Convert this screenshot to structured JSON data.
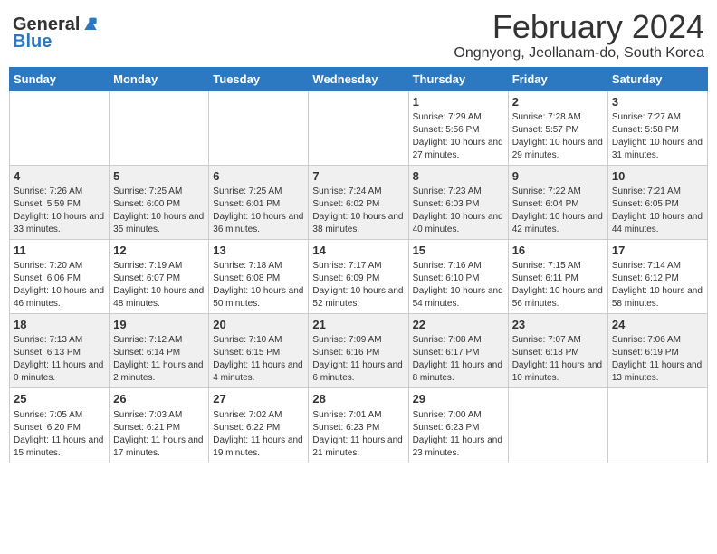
{
  "header": {
    "logo_general": "General",
    "logo_blue": "Blue",
    "title": "February 2024",
    "subtitle": "Ongnyong, Jeollanam-do, South Korea"
  },
  "days_of_week": [
    "Sunday",
    "Monday",
    "Tuesday",
    "Wednesday",
    "Thursday",
    "Friday",
    "Saturday"
  ],
  "weeks": [
    {
      "days": [
        {
          "num": "",
          "info": ""
        },
        {
          "num": "",
          "info": ""
        },
        {
          "num": "",
          "info": ""
        },
        {
          "num": "",
          "info": ""
        },
        {
          "num": "1",
          "info": "Sunrise: 7:29 AM\nSunset: 5:56 PM\nDaylight: 10 hours and 27 minutes."
        },
        {
          "num": "2",
          "info": "Sunrise: 7:28 AM\nSunset: 5:57 PM\nDaylight: 10 hours and 29 minutes."
        },
        {
          "num": "3",
          "info": "Sunrise: 7:27 AM\nSunset: 5:58 PM\nDaylight: 10 hours and 31 minutes."
        }
      ]
    },
    {
      "days": [
        {
          "num": "4",
          "info": "Sunrise: 7:26 AM\nSunset: 5:59 PM\nDaylight: 10 hours and 33 minutes."
        },
        {
          "num": "5",
          "info": "Sunrise: 7:25 AM\nSunset: 6:00 PM\nDaylight: 10 hours and 35 minutes."
        },
        {
          "num": "6",
          "info": "Sunrise: 7:25 AM\nSunset: 6:01 PM\nDaylight: 10 hours and 36 minutes."
        },
        {
          "num": "7",
          "info": "Sunrise: 7:24 AM\nSunset: 6:02 PM\nDaylight: 10 hours and 38 minutes."
        },
        {
          "num": "8",
          "info": "Sunrise: 7:23 AM\nSunset: 6:03 PM\nDaylight: 10 hours and 40 minutes."
        },
        {
          "num": "9",
          "info": "Sunrise: 7:22 AM\nSunset: 6:04 PM\nDaylight: 10 hours and 42 minutes."
        },
        {
          "num": "10",
          "info": "Sunrise: 7:21 AM\nSunset: 6:05 PM\nDaylight: 10 hours and 44 minutes."
        }
      ]
    },
    {
      "days": [
        {
          "num": "11",
          "info": "Sunrise: 7:20 AM\nSunset: 6:06 PM\nDaylight: 10 hours and 46 minutes."
        },
        {
          "num": "12",
          "info": "Sunrise: 7:19 AM\nSunset: 6:07 PM\nDaylight: 10 hours and 48 minutes."
        },
        {
          "num": "13",
          "info": "Sunrise: 7:18 AM\nSunset: 6:08 PM\nDaylight: 10 hours and 50 minutes."
        },
        {
          "num": "14",
          "info": "Sunrise: 7:17 AM\nSunset: 6:09 PM\nDaylight: 10 hours and 52 minutes."
        },
        {
          "num": "15",
          "info": "Sunrise: 7:16 AM\nSunset: 6:10 PM\nDaylight: 10 hours and 54 minutes."
        },
        {
          "num": "16",
          "info": "Sunrise: 7:15 AM\nSunset: 6:11 PM\nDaylight: 10 hours and 56 minutes."
        },
        {
          "num": "17",
          "info": "Sunrise: 7:14 AM\nSunset: 6:12 PM\nDaylight: 10 hours and 58 minutes."
        }
      ]
    },
    {
      "days": [
        {
          "num": "18",
          "info": "Sunrise: 7:13 AM\nSunset: 6:13 PM\nDaylight: 11 hours and 0 minutes."
        },
        {
          "num": "19",
          "info": "Sunrise: 7:12 AM\nSunset: 6:14 PM\nDaylight: 11 hours and 2 minutes."
        },
        {
          "num": "20",
          "info": "Sunrise: 7:10 AM\nSunset: 6:15 PM\nDaylight: 11 hours and 4 minutes."
        },
        {
          "num": "21",
          "info": "Sunrise: 7:09 AM\nSunset: 6:16 PM\nDaylight: 11 hours and 6 minutes."
        },
        {
          "num": "22",
          "info": "Sunrise: 7:08 AM\nSunset: 6:17 PM\nDaylight: 11 hours and 8 minutes."
        },
        {
          "num": "23",
          "info": "Sunrise: 7:07 AM\nSunset: 6:18 PM\nDaylight: 11 hours and 10 minutes."
        },
        {
          "num": "24",
          "info": "Sunrise: 7:06 AM\nSunset: 6:19 PM\nDaylight: 11 hours and 13 minutes."
        }
      ]
    },
    {
      "days": [
        {
          "num": "25",
          "info": "Sunrise: 7:05 AM\nSunset: 6:20 PM\nDaylight: 11 hours and 15 minutes."
        },
        {
          "num": "26",
          "info": "Sunrise: 7:03 AM\nSunset: 6:21 PM\nDaylight: 11 hours and 17 minutes."
        },
        {
          "num": "27",
          "info": "Sunrise: 7:02 AM\nSunset: 6:22 PM\nDaylight: 11 hours and 19 minutes."
        },
        {
          "num": "28",
          "info": "Sunrise: 7:01 AM\nSunset: 6:23 PM\nDaylight: 11 hours and 21 minutes."
        },
        {
          "num": "29",
          "info": "Sunrise: 7:00 AM\nSunset: 6:23 PM\nDaylight: 11 hours and 23 minutes."
        },
        {
          "num": "",
          "info": ""
        },
        {
          "num": "",
          "info": ""
        }
      ]
    }
  ]
}
